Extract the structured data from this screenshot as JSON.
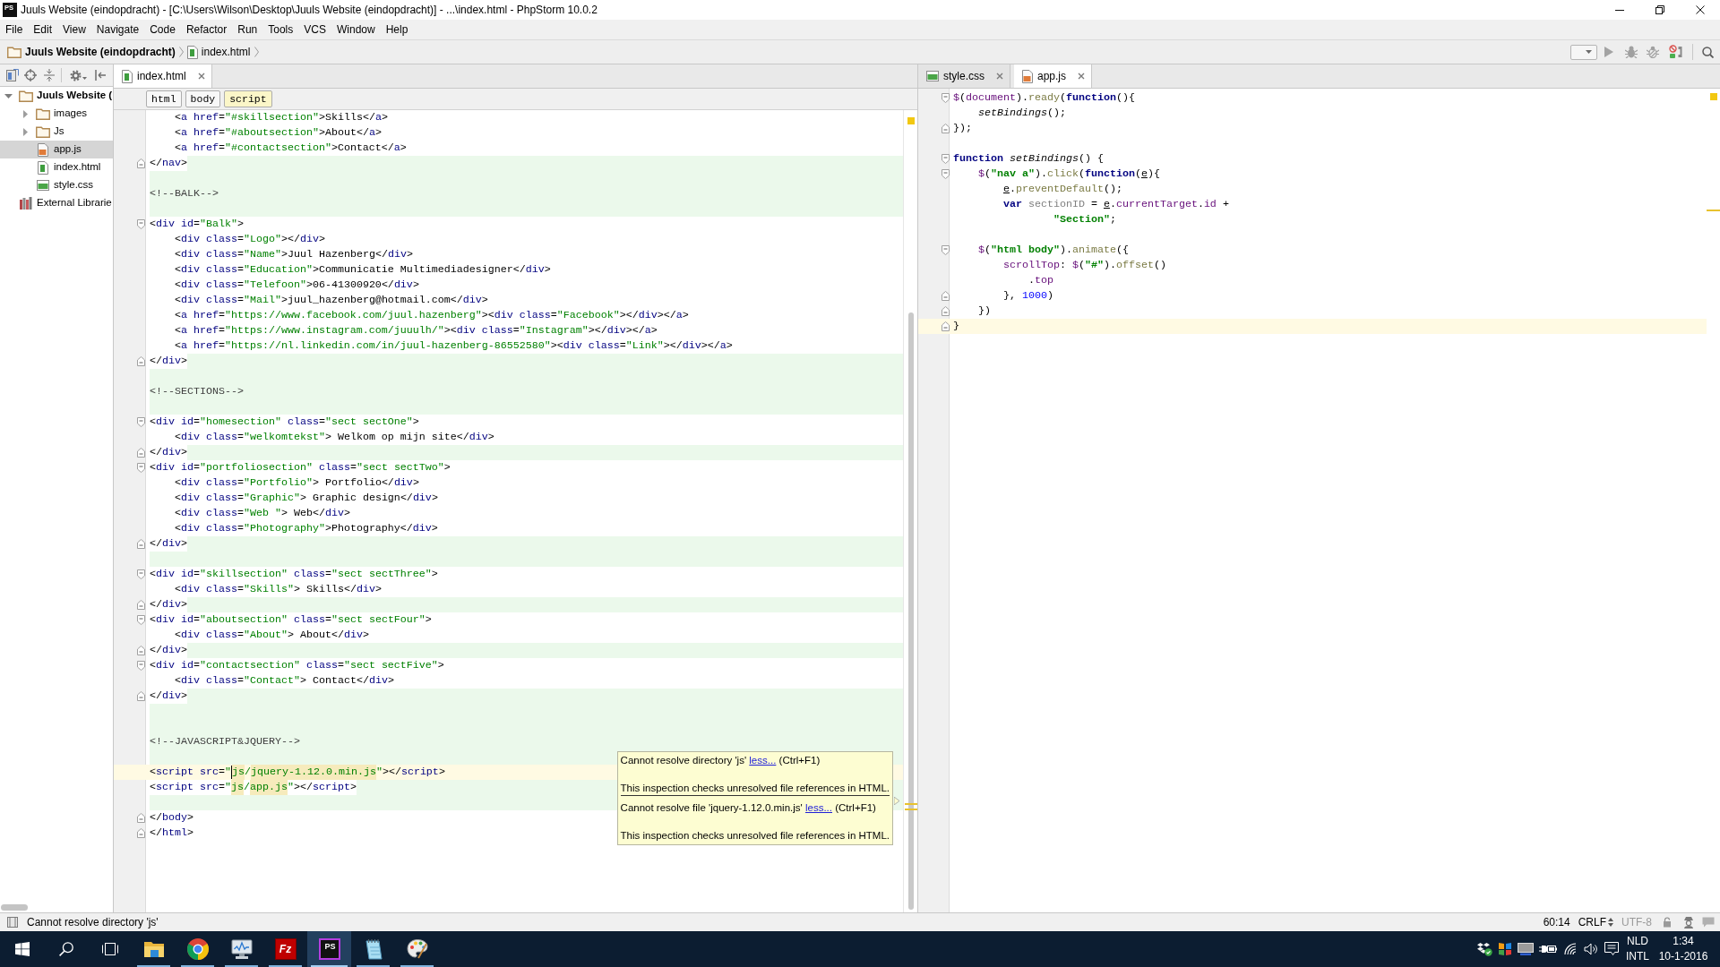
{
  "window": {
    "logo": "PS",
    "title": "Juuls Website (eindopdracht) - [C:\\Users\\Wilson\\Desktop\\Juuls Website (eindopdracht)] - ...\\index.html - PhpStorm 10.0.2"
  },
  "menu_bar": [
    "File",
    "Edit",
    "View",
    "Navigate",
    "Code",
    "Refactor",
    "Run",
    "Tools",
    "VCS",
    "Window",
    "Help"
  ],
  "navbar": {
    "crumbs": [
      {
        "label": "Juuls Website (eindopdracht)",
        "kind": "project"
      },
      {
        "label": "index.html",
        "kind": "html"
      }
    ]
  },
  "project": {
    "tree": [
      {
        "label": "Juuls Website (",
        "kind": "project",
        "expanded": true,
        "selected": false,
        "children": [
          {
            "label": "images",
            "kind": "folder",
            "expanded": false,
            "selected": false
          },
          {
            "label": "Js",
            "kind": "folder",
            "expanded": false,
            "selected": false
          },
          {
            "label": "app.js",
            "kind": "js",
            "selected": true
          },
          {
            "label": "index.html",
            "kind": "html",
            "selected": false
          },
          {
            "label": "style.css",
            "kind": "css",
            "selected": false
          }
        ]
      },
      {
        "label": "External Librarie",
        "kind": "library",
        "selected": false
      }
    ]
  },
  "editors": [
    {
      "tabs": [
        {
          "label": "index.html",
          "kind": "html",
          "selected": true
        }
      ],
      "breadcrumbs": [
        {
          "label": "html",
          "selected": false
        },
        {
          "label": "body",
          "selected": false
        },
        {
          "label": "script",
          "selected": true
        }
      ],
      "lines": [
        {
          "text": "    <a href=\"#skillsection\">Skills</a>",
          "kind": "plain",
          "current": false
        },
        {
          "text": "    <a href=\"#aboutsection\">About</a>",
          "kind": "plain",
          "current": false
        },
        {
          "text": "    <a href=\"#contactsection\">Contact</a>",
          "kind": "plain",
          "current": false
        },
        {
          "text": "</nav>",
          "kind": "tail",
          "current": false,
          "fold": {
            "kind": "end"
          }
        },
        {
          "kind": "added",
          "current": false
        },
        {
          "text": "<!--BALK-->",
          "kind": "added",
          "current": false
        },
        {
          "kind": "added",
          "current": false
        },
        {
          "text": "<div id=\"Balk\">",
          "kind": "plain",
          "current": false,
          "fold": {
            "kind": "start"
          }
        },
        {
          "text": "    <div class=\"Logo\"></div>",
          "kind": "plain",
          "current": false
        },
        {
          "text": "    <div class=\"Name\">Juul Hazenberg</div>",
          "kind": "plain",
          "current": false
        },
        {
          "text": "    <div class=\"Education\">Communicatie Multimediadesigner</div>",
          "kind": "plain",
          "current": false
        },
        {
          "text": "    <div class=\"Telefoon\">06-41300920</div>",
          "kind": "plain",
          "current": false
        },
        {
          "text": "    <div class=\"Mail\">juul_hazenberg@hotmail.com</div>",
          "kind": "plain",
          "current": false
        },
        {
          "text": "    <a href=\"https://www.facebook.com/juul.hazenberg\"><div class=\"Facebook\"></div></a>",
          "kind": "plain",
          "current": false
        },
        {
          "text": "    <a href=\"https://www.instagram.com/juuulh/\"><div class=\"Instagram\"></div></a>",
          "kind": "plain",
          "current": false
        },
        {
          "text": "    <a href=\"https://nl.linkedin.com/in/juul-hazenberg-86552580\"><div class=\"Link\"></div></a>",
          "kind": "plain",
          "current": false
        },
        {
          "text": "</div>",
          "kind": "tail",
          "current": false,
          "fold": {
            "kind": "end"
          }
        },
        {
          "kind": "added",
          "current": false
        },
        {
          "text": "<!--SECTIONS-->",
          "kind": "added",
          "current": false
        },
        {
          "kind": "added",
          "current": false
        },
        {
          "text": "<div id=\"homesection\" class=\"sect sectOne\">",
          "kind": "plain",
          "current": false,
          "fold": {
            "kind": "start"
          }
        },
        {
          "text": "    <div class=\"welkomtekst\"> Welkom op mijn site</div>",
          "kind": "plain",
          "current": false
        },
        {
          "text": "</div>",
          "kind": "tail",
          "current": false,
          "fold": {
            "kind": "end"
          }
        },
        {
          "text": "<div id=\"portfoliosection\" class=\"sect sectTwo\">",
          "kind": "plain",
          "current": false,
          "fold": {
            "kind": "start"
          }
        },
        {
          "text": "    <div class=\"Portfolio\"> Portfolio</div>",
          "kind": "plain",
          "current": false
        },
        {
          "text": "    <div class=\"Graphic\"> Graphic design</div>",
          "kind": "plain",
          "current": false
        },
        {
          "text": "    <div class=\"Web \"> Web</div>",
          "kind": "plain",
          "current": false
        },
        {
          "text": "    <div class=\"Photography\">Photography</div>",
          "kind": "plain",
          "current": false
        },
        {
          "text": "</div>",
          "kind": "tail",
          "current": false,
          "fold": {
            "kind": "end"
          }
        },
        {
          "kind": "added",
          "current": false
        },
        {
          "text": "<div id=\"skillsection\" class=\"sect sectThree\">",
          "kind": "plain",
          "current": false,
          "fold": {
            "kind": "start"
          }
        },
        {
          "text": "    <div class=\"Skills\"> Skills</div>",
          "kind": "plain",
          "current": false
        },
        {
          "text": "</div>",
          "kind": "tail",
          "current": false,
          "fold": {
            "kind": "end"
          }
        },
        {
          "text": "<div id=\"aboutsection\" class=\"sect sectFour\">",
          "kind": "plain",
          "current": false,
          "fold": {
            "kind": "start"
          }
        },
        {
          "text": "    <div class=\"About\"> About</div>",
          "kind": "plain",
          "current": false
        },
        {
          "text": "</div>",
          "kind": "tail",
          "current": false,
          "fold": {
            "kind": "end"
          }
        },
        {
          "text": "<div id=\"contactsection\" class=\"sect sectFive\">",
          "kind": "plain",
          "current": false,
          "fold": {
            "kind": "start"
          }
        },
        {
          "text": "    <div class=\"Contact\"> Contact</div>",
          "kind": "plain",
          "current": false
        },
        {
          "text": "</div>",
          "kind": "tail",
          "current": false,
          "fold": {
            "kind": "end"
          }
        },
        {
          "kind": "added",
          "current": false
        },
        {
          "kind": "added",
          "current": false
        },
        {
          "text": "<!--JAVASCRIPT&JQUERY-->",
          "kind": "added",
          "current": false
        },
        {
          "kind": "added",
          "current": false
        },
        {
          "parts": [
            {
              "kind": "code",
              "text": "<script src=\"",
              "warning": false
            },
            {
              "kind": "caret"
            },
            {
              "kind": "code",
              "text": "js",
              "warning": true
            },
            {
              "kind": "code",
              "text": "/",
              "warning": false
            },
            {
              "kind": "code",
              "text": "jquery-1.12.0.min.js",
              "warning": true
            },
            {
              "kind": "code",
              "text": "\"></script>",
              "warning": false
            }
          ],
          "kind": "plain",
          "current": true
        },
        {
          "parts": [
            {
              "kind": "code",
              "text": "<script src=\"",
              "warning": false
            },
            {
              "kind": "code",
              "text": "js",
              "warning": true
            },
            {
              "kind": "code",
              "text": "/",
              "warning": false
            },
            {
              "kind": "code",
              "text": "app.js",
              "warning": true
            },
            {
              "kind": "code",
              "text": "\"></script>",
              "warning": false
            }
          ],
          "kind": "tail",
          "current": false
        },
        {
          "kind": "added",
          "current": false
        },
        {
          "text": "</body>",
          "kind": "plain",
          "current": false,
          "fold": {
            "kind": "end"
          }
        },
        {
          "text": "</html>",
          "kind": "plain",
          "current": false,
          "fold": {
            "kind": "end"
          }
        }
      ],
      "tooltip": {
        "problems": [
          {
            "message": "Cannot resolve directory 'js'",
            "link": "less...",
            "shortcut": "(Ctrl+F1)",
            "description": "This inspection checks unresolved file references in HTML."
          },
          {
            "message": "Cannot resolve file 'jquery-1.12.0.min.js'",
            "link": "less...",
            "shortcut": "(Ctrl+F1)",
            "description": "This inspection checks unresolved file references in HTML."
          }
        ]
      }
    },
    {
      "tabs": [
        {
          "label": "style.css",
          "kind": "css",
          "selected": false
        },
        {
          "label": "app.js",
          "kind": "js",
          "selected": true
        }
      ],
      "lines": [
        {
          "tokens": [
            {
              "text": "$",
              "kind": "field"
            },
            {
              "text": "(",
              "kind": "plain"
            },
            {
              "text": "document",
              "kind": "field"
            },
            {
              "text": ").",
              "kind": "plain"
            },
            {
              "text": "ready",
              "kind": "method"
            },
            {
              "text": "(",
              "kind": "plain"
            },
            {
              "text": "function",
              "kind": "keyword"
            },
            {
              "text": "(){",
              "kind": "plain"
            }
          ],
          "current": false,
          "fold": {
            "kind": "start"
          }
        },
        {
          "tokens": [
            {
              "text": "    setBindings",
              "kind": "call"
            },
            {
              "text": "();",
              "kind": "plain"
            }
          ],
          "current": false
        },
        {
          "tokens": [
            {
              "text": "});",
              "kind": "plain"
            }
          ],
          "current": false,
          "fold": {
            "kind": "end"
          }
        },
        {
          "current": false
        },
        {
          "tokens": [
            {
              "text": "function ",
              "kind": "keyword"
            },
            {
              "text": "setBindings",
              "kind": "call"
            },
            {
              "text": "() {",
              "kind": "plain"
            }
          ],
          "current": false,
          "fold": {
            "kind": "start"
          }
        },
        {
          "tokens": [
            {
              "text": "    $",
              "kind": "field"
            },
            {
              "text": "(",
              "kind": "plain"
            },
            {
              "text": "\"nav a\"",
              "kind": "string"
            },
            {
              "text": ").",
              "kind": "plain"
            },
            {
              "text": "click",
              "kind": "method"
            },
            {
              "text": "(",
              "kind": "plain"
            },
            {
              "text": "function",
              "kind": "keyword"
            },
            {
              "text": "(",
              "kind": "plain"
            },
            {
              "text": "e",
              "kind": "param"
            },
            {
              "text": "){",
              "kind": "plain"
            }
          ],
          "current": false,
          "fold": {
            "kind": "start"
          }
        },
        {
          "tokens": [
            {
              "text": "        e",
              "kind": "param"
            },
            {
              "text": ".",
              "kind": "plain"
            },
            {
              "text": "preventDefault",
              "kind": "method"
            },
            {
              "text": "();",
              "kind": "plain"
            }
          ],
          "current": false
        },
        {
          "tokens": [
            {
              "text": "        var ",
              "kind": "keyword"
            },
            {
              "text": "sectionID",
              "kind": "unused"
            },
            {
              "text": " = ",
              "kind": "plain"
            },
            {
              "text": "e",
              "kind": "param"
            },
            {
              "text": ".",
              "kind": "plain"
            },
            {
              "text": "currentTarget",
              "kind": "field"
            },
            {
              "text": ".",
              "kind": "plain"
            },
            {
              "text": "id",
              "kind": "field"
            },
            {
              "text": " +",
              "kind": "plain"
            }
          ],
          "current": false
        },
        {
          "tokens": [
            {
              "text": "                \"Section\"",
              "kind": "string"
            },
            {
              "text": ";",
              "kind": "plain"
            }
          ],
          "current": false
        },
        {
          "current": false
        },
        {
          "tokens": [
            {
              "text": "    $",
              "kind": "field"
            },
            {
              "text": "(",
              "kind": "plain"
            },
            {
              "text": "\"html body\"",
              "kind": "string"
            },
            {
              "text": ").",
              "kind": "plain"
            },
            {
              "text": "animate",
              "kind": "method"
            },
            {
              "text": "({",
              "kind": "plain"
            }
          ],
          "current": false,
          "fold": {
            "kind": "start"
          }
        },
        {
          "tokens": [
            {
              "text": "        scrollTop",
              "kind": "field"
            },
            {
              "text": ": ",
              "kind": "plain"
            },
            {
              "text": "$",
              "kind": "field"
            },
            {
              "text": "(",
              "kind": "plain"
            },
            {
              "text": "\"#\"",
              "kind": "string"
            },
            {
              "text": ").",
              "kind": "plain"
            },
            {
              "text": "offset",
              "kind": "method"
            },
            {
              "text": "()",
              "kind": "plain"
            }
          ],
          "current": false
        },
        {
          "tokens": [
            {
              "text": "            .",
              "kind": "plain"
            },
            {
              "text": "top",
              "kind": "field"
            }
          ],
          "current": false
        },
        {
          "tokens": [
            {
              "text": "        }, ",
              "kind": "plain"
            },
            {
              "text": "1000",
              "kind": "number"
            },
            {
              "text": ")",
              "kind": "plain"
            }
          ],
          "current": false,
          "fold": {
            "kind": "end"
          }
        },
        {
          "tokens": [
            {
              "text": "    })",
              "kind": "plain"
            }
          ],
          "current": false,
          "fold": {
            "kind": "end"
          }
        },
        {
          "tokens": [
            {
              "text": "}",
              "kind": "plain"
            }
          ],
          "current": true,
          "fold": {
            "kind": "end"
          }
        }
      ]
    }
  ],
  "status_bar": {
    "message": "Cannot resolve directory 'js'",
    "caret_position": "60:14",
    "line_separator": "CRLF",
    "encoding": {
      "label": "UTF-8",
      "disabled": true
    }
  },
  "taskbar": {
    "apps": [
      {
        "kind": "folder",
        "running": true,
        "selected": false
      },
      {
        "kind": "browser",
        "running": true,
        "selected": false
      },
      {
        "kind": "monitor",
        "running": true,
        "selected": false
      },
      {
        "kind": "ftp",
        "logo": "Fz",
        "running": true,
        "selected": false
      },
      {
        "kind": "ide",
        "logo": "PS",
        "running": true,
        "selected": true
      },
      {
        "kind": "notepad",
        "running": true,
        "selected": false
      },
      {
        "kind": "paint",
        "running": true,
        "selected": false
      }
    ],
    "language": "NLD",
    "layout": "INTL",
    "time": "1:34",
    "date": "10-1-2016"
  }
}
